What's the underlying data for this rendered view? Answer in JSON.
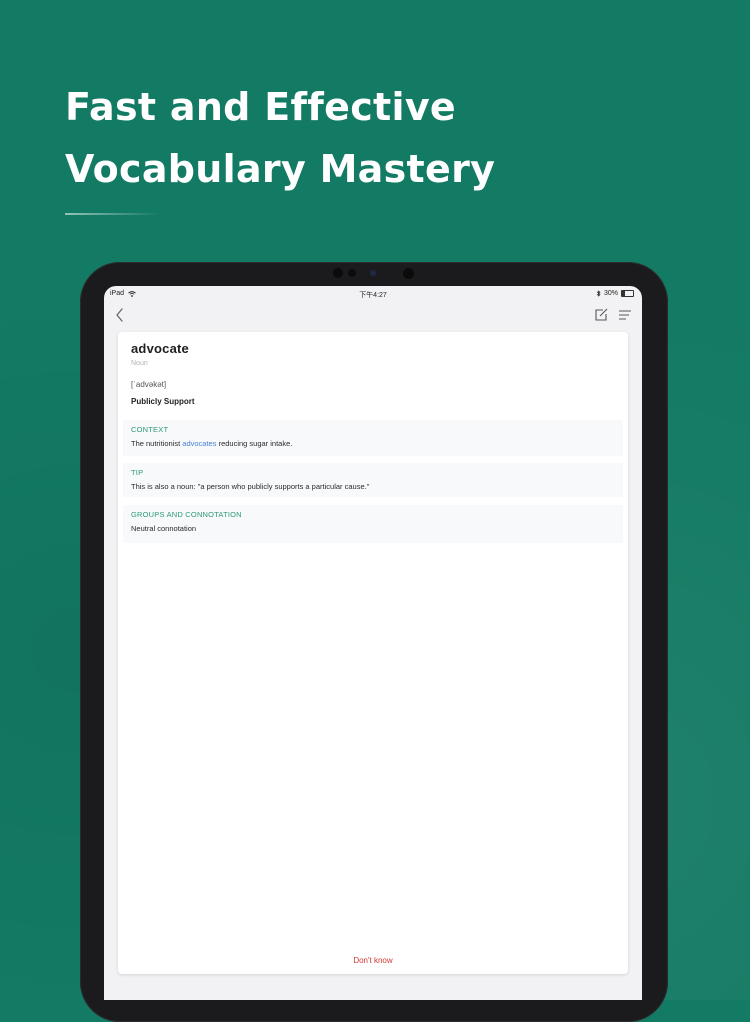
{
  "headline": {
    "line1": "Fast and Effective",
    "line2": "Vocabulary Mastery"
  },
  "status_bar": {
    "device": "iPad",
    "time": "下午4:27",
    "battery": "30%"
  },
  "card": {
    "word": "advocate",
    "part_of_speech": "Noun",
    "phonetic": "[ˈadvəkət]",
    "meaning": "Publicly Support",
    "sections": [
      {
        "title": "CONTEXT",
        "text_before": "The nutritionist ",
        "highlight": "advocates",
        "text_after": " reducing sugar intake."
      },
      {
        "title": "TIP",
        "text": "This is also a noun: \"a person who publicly supports a particular cause.\""
      },
      {
        "title": "GROUPS AND CONNOTATION",
        "text": "Neutral connotation"
      }
    ],
    "dont_know_label": "Don't know"
  },
  "colors": {
    "background": "#137a63",
    "accent": "#2c9a74",
    "highlight": "#4a7fd6",
    "danger": "#d13b30"
  },
  "icons": [
    "wifi-icon",
    "bluetooth-icon",
    "battery-icon",
    "back-icon",
    "edit-icon",
    "menu-icon"
  ]
}
